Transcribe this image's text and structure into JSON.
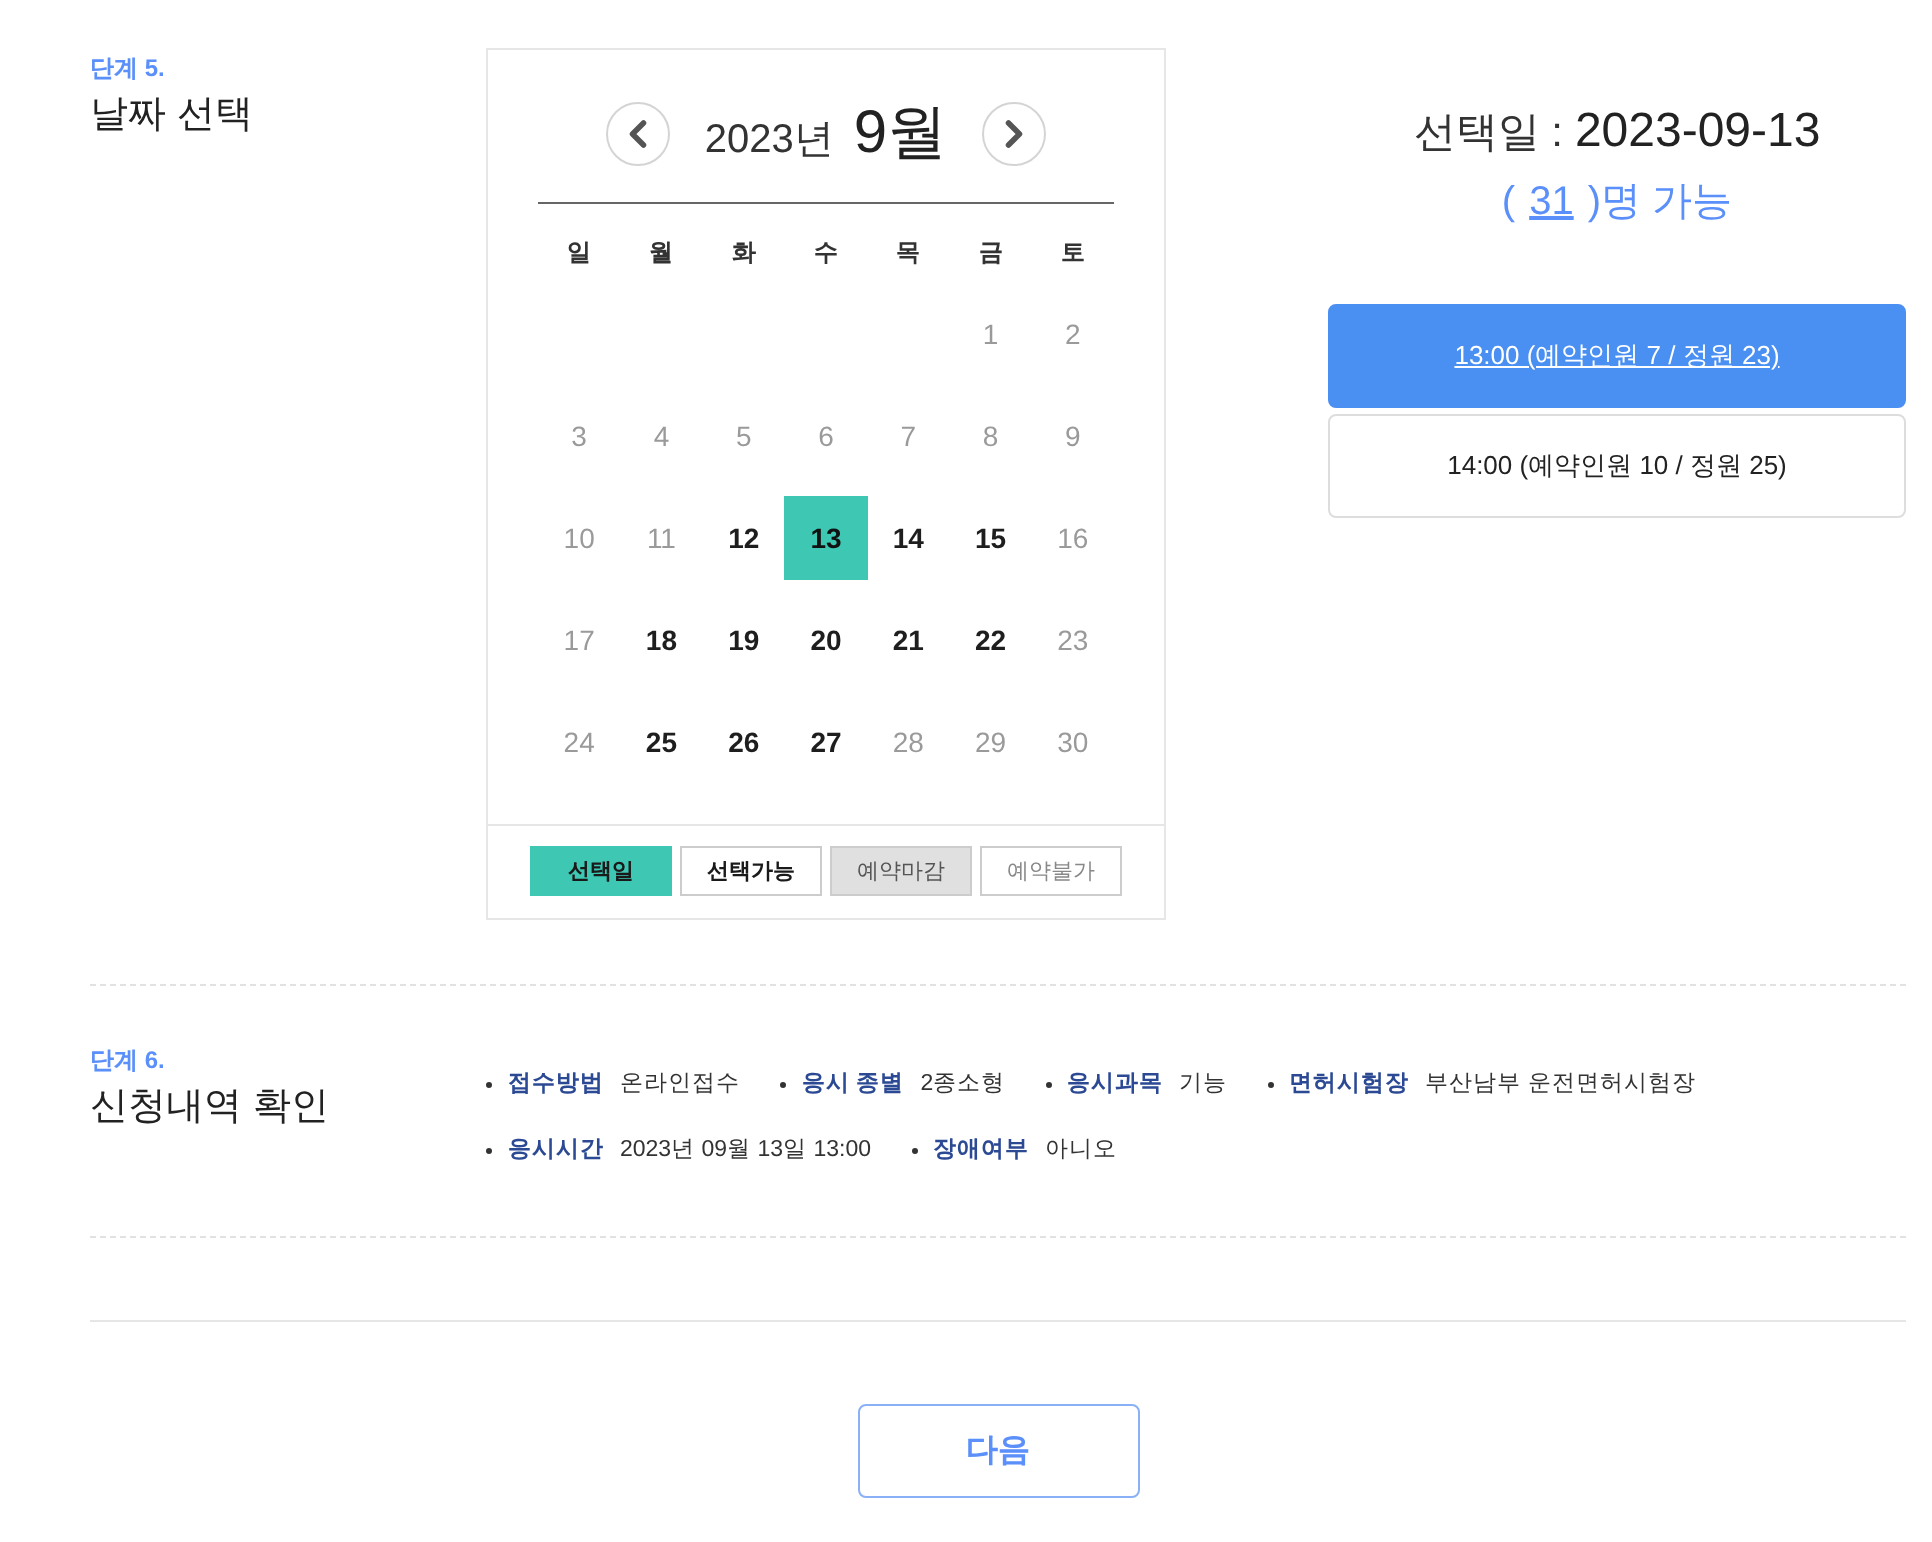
{
  "step5": {
    "step": "단계 5.",
    "title": "날짜 선택"
  },
  "calendar": {
    "year": "2023년",
    "month": "9월",
    "weekdays": [
      "일",
      "월",
      "화",
      "수",
      "목",
      "금",
      "토"
    ],
    "weeks": [
      [
        {
          "day": "1",
          "disabled": true,
          "selected": false
        },
        {
          "day": "2",
          "disabled": true,
          "selected": false
        }
      ],
      [
        {
          "day": "3",
          "disabled": true,
          "selected": false
        },
        {
          "day": "4",
          "disabled": true,
          "selected": false
        },
        {
          "day": "5",
          "disabled": true,
          "selected": false
        },
        {
          "day": "6",
          "disabled": true,
          "selected": false
        },
        {
          "day": "7",
          "disabled": true,
          "selected": false
        },
        {
          "day": "8",
          "disabled": true,
          "selected": false
        },
        {
          "day": "9",
          "disabled": true,
          "selected": false
        }
      ],
      [
        {
          "day": "10",
          "disabled": true,
          "selected": false
        },
        {
          "day": "11",
          "disabled": true,
          "selected": false
        },
        {
          "day": "12",
          "disabled": false,
          "selected": false
        },
        {
          "day": "13",
          "disabled": false,
          "selected": true
        },
        {
          "day": "14",
          "disabled": false,
          "selected": false
        },
        {
          "day": "15",
          "disabled": false,
          "selected": false
        },
        {
          "day": "16",
          "disabled": true,
          "selected": false
        }
      ],
      [
        {
          "day": "17",
          "disabled": true,
          "selected": false
        },
        {
          "day": "18",
          "disabled": false,
          "selected": false
        },
        {
          "day": "19",
          "disabled": false,
          "selected": false
        },
        {
          "day": "20",
          "disabled": false,
          "selected": false
        },
        {
          "day": "21",
          "disabled": false,
          "selected": false
        },
        {
          "day": "22",
          "disabled": false,
          "selected": false
        },
        {
          "day": "23",
          "disabled": true,
          "selected": false
        }
      ],
      [
        {
          "day": "24",
          "disabled": true,
          "selected": false
        },
        {
          "day": "25",
          "disabled": false,
          "selected": false
        },
        {
          "day": "26",
          "disabled": false,
          "selected": false
        },
        {
          "day": "27",
          "disabled": false,
          "selected": false
        },
        {
          "day": "28",
          "disabled": true,
          "selected": false
        },
        {
          "day": "29",
          "disabled": true,
          "selected": false
        },
        {
          "day": "30",
          "disabled": true,
          "selected": false
        }
      ]
    ],
    "legend": [
      {
        "label": "선택일",
        "kind": "selected"
      },
      {
        "label": "선택가능",
        "kind": "available"
      },
      {
        "label": "예약마감",
        "kind": "closed"
      },
      {
        "label": "예약불가",
        "kind": "unavailable"
      }
    ]
  },
  "selection": {
    "label": "선택일 :",
    "date": "2023-09-13",
    "count_open": "(",
    "count": "31",
    "count_close": ")명 가능"
  },
  "time_slots": [
    {
      "label": "13:00 (예약인원 7 / 정원 23)",
      "selected": true
    },
    {
      "label": "14:00 (예약인원 10 / 정원 25)",
      "selected": false
    }
  ],
  "step6": {
    "step": "단계 6.",
    "title": "신청내역 확인",
    "rows": [
      [
        {
          "label": "접수방법",
          "value": "온라인접수"
        },
        {
          "label": "응시 종별",
          "value": "2종소형"
        },
        {
          "label": "응시과목",
          "value": "기능"
        },
        {
          "label": "면허시험장",
          "value": "부산남부 운전면허시험장"
        }
      ],
      [
        {
          "label": "응시시간",
          "value": "2023년 09월 13일 13:00"
        },
        {
          "label": "장애여부",
          "value": "아니오"
        }
      ]
    ]
  },
  "next_button": "다음"
}
